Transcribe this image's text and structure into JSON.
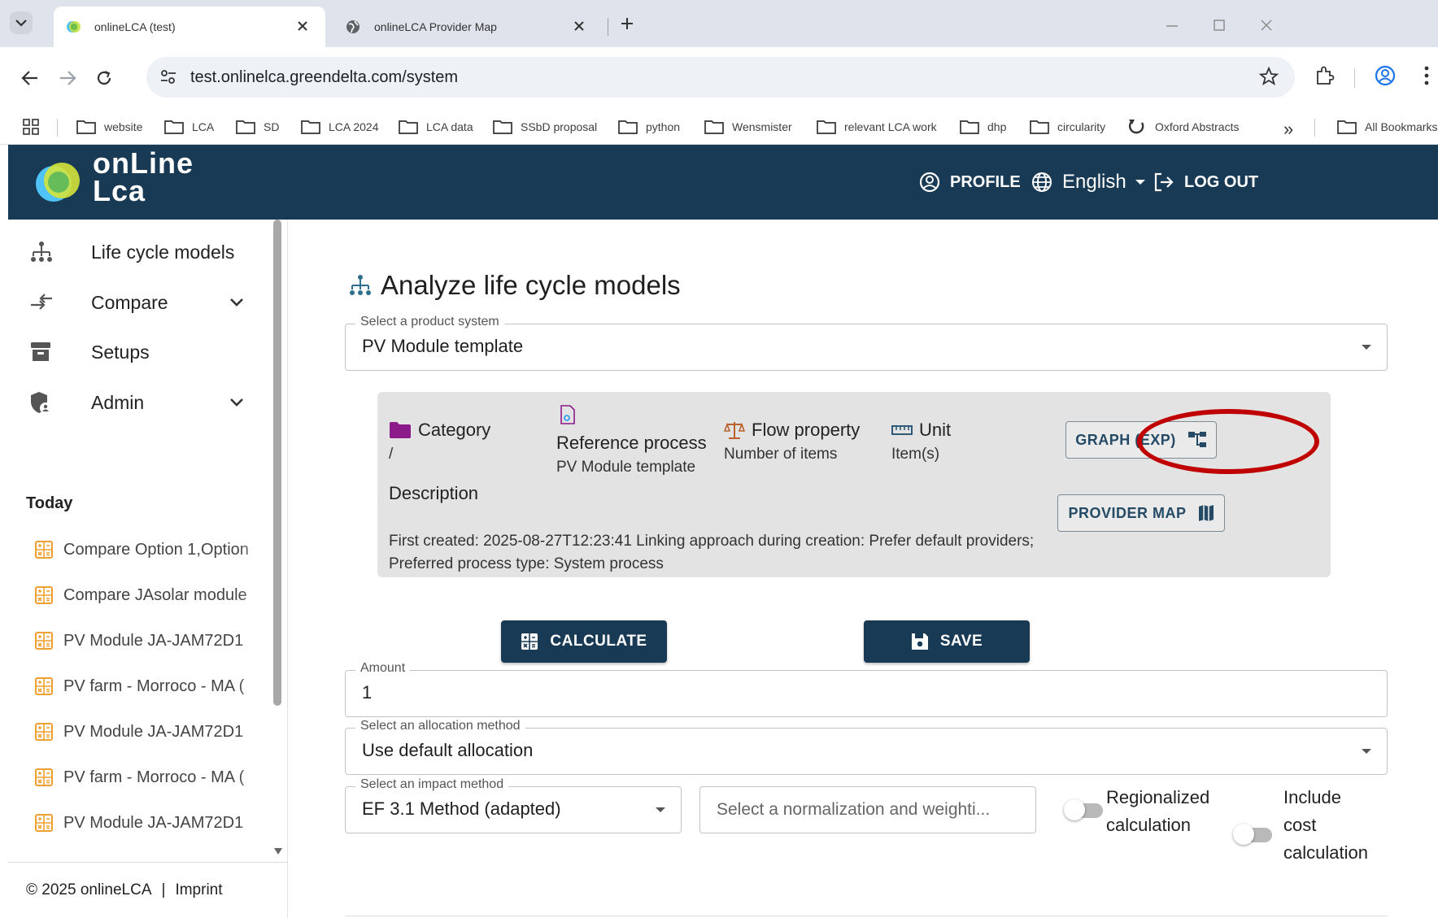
{
  "browser": {
    "tabs": [
      {
        "title": "onlineLCA (test)",
        "active": true
      },
      {
        "title": "onlineLCA Provider Map",
        "active": false
      }
    ],
    "url": "test.onlinelca.greendelta.com/system",
    "bookmarks": [
      "website",
      "LCA",
      "SD",
      "LCA 2024",
      "LCA data",
      "SSbD proposal",
      "python",
      "Wensmister",
      "relevant LCA work",
      "dhp",
      "circularity",
      "Oxford Abstracts"
    ],
    "more_bookmarks": "»",
    "all_bookmarks": "All Bookmarks"
  },
  "app": {
    "logo_line1": "onLine",
    "logo_line2": "Lca",
    "profile": "PROFILE",
    "language": "English",
    "logout": "LOG OUT",
    "colors": {
      "header": "#183a55",
      "highlight": "#c00000",
      "folder": "#8b1a8b",
      "recent_icon": "#f0a030"
    }
  },
  "sidebar": {
    "nav": [
      {
        "label": "Life cycle models",
        "icon": "hierarchy-icon",
        "expandable": false
      },
      {
        "label": "Compare",
        "icon": "compare-arrows-icon",
        "expandable": true
      },
      {
        "label": "Setups",
        "icon": "archive-icon",
        "expandable": false
      },
      {
        "label": "Admin",
        "icon": "shield-user-icon",
        "expandable": true
      }
    ],
    "today_label": "Today",
    "recent": [
      "Compare Option 1,Option",
      "Compare JAsolar module",
      "PV Module JA-JAM72D1",
      "PV farm - Morroco - MA (",
      "PV Module JA-JAM72D1",
      "PV farm - Morroco - MA (",
      "PV Module JA-JAM72D1"
    ],
    "footer_copyright": "© 2025 onlineLCA",
    "footer_sep": "|",
    "footer_imprint": "Imprint"
  },
  "main": {
    "title": "Analyze life cycle models",
    "product_system": {
      "label": "Select a product system",
      "value": "PV Module template"
    },
    "info": {
      "category_label": "Category",
      "category_value": "/",
      "ref_process_label": "Reference process",
      "ref_process_value": "PV Module template",
      "flow_property_label": "Flow property",
      "flow_property_value": "Number of items",
      "unit_label": "Unit",
      "unit_value": "Item(s)",
      "description_label": "Description",
      "description_text": "First created: 2025-08-27T12:23:41 Linking approach during creation: Prefer default providers; Preferred process type: System process",
      "graph_button": "GRAPH (EXP)",
      "provider_map_button": "PROVIDER MAP"
    },
    "calculate_button": "CALCULATE",
    "save_button": "SAVE",
    "amount": {
      "label": "Amount",
      "value": "1"
    },
    "allocation": {
      "label": "Select an allocation method",
      "value": "Use default allocation"
    },
    "impact": {
      "label": "Select an impact method",
      "value": "EF 3.1 Method (adapted)"
    },
    "nw_placeholder": "Select a normalization and weighti...",
    "regionalized_line1": "Regionalized",
    "regionalized_line2": "calculation",
    "cost_line1": "Include",
    "cost_line2": "cost",
    "cost_line3": "calculation"
  }
}
